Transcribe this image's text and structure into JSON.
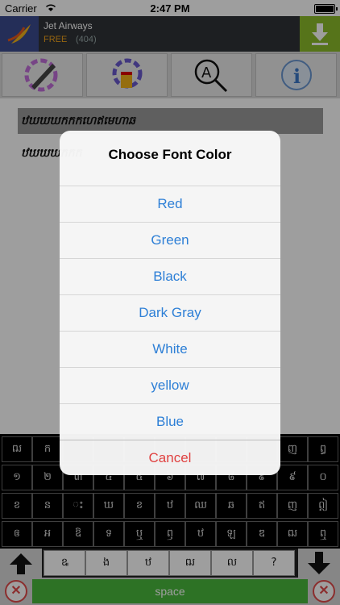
{
  "status": {
    "carrier": "Carrier",
    "time": "2:47 PM"
  },
  "ad": {
    "title": "Jet Airways",
    "price": "FREE",
    "count": "(404)"
  },
  "toolbar": {
    "items": [
      "pencil-color-icon",
      "paint-bucket-icon",
      "search-font-icon",
      "info-icon"
    ]
  },
  "text": {
    "line1": "ឋឃឃឃកកកហេឥមេហាឆ",
    "line2": "ឋឃឃឃកកក"
  },
  "keyboard": {
    "rows": [
      [
        "ឍ",
        "ក",
        "",
        "",
        "",
        "",
        "",
        "",
        "",
        "ញ",
        "ឰ"
      ],
      [
        "១",
        "២",
        "៣",
        "៤",
        "៥",
        "៦",
        "៧",
        "៨",
        "៩",
        "៩",
        "០"
      ],
      [
        "ខ",
        "ន",
        "ះ",
        "ឃ",
        "ខ",
        "ឋ",
        "ឈ",
        "ឆ",
        "ឥ",
        "ញ",
        "ឦ"
      ],
      [
        "ឲ",
        "ឣ",
        "ឱ",
        "ទ",
        "ឬ",
        "ឭ",
        "ឋ",
        "ឡ",
        "ឌ",
        "ឍ",
        "ឮ"
      ]
    ],
    "bottom": [
      "ឩ",
      "ង",
      "ឋ",
      "ឍ",
      "ល",
      "?"
    ],
    "space_label": "space"
  },
  "dialog": {
    "title": "Choose Font Color",
    "options": [
      "Red",
      "Green",
      "Black",
      "Dark Gray",
      "White",
      "yellow",
      "Blue"
    ],
    "cancel": "Cancel"
  },
  "colors": {
    "option": "#2d7fd6",
    "cancel": "#e04140",
    "space": "#49b93c",
    "ad_dl": "#8cbb2a"
  }
}
